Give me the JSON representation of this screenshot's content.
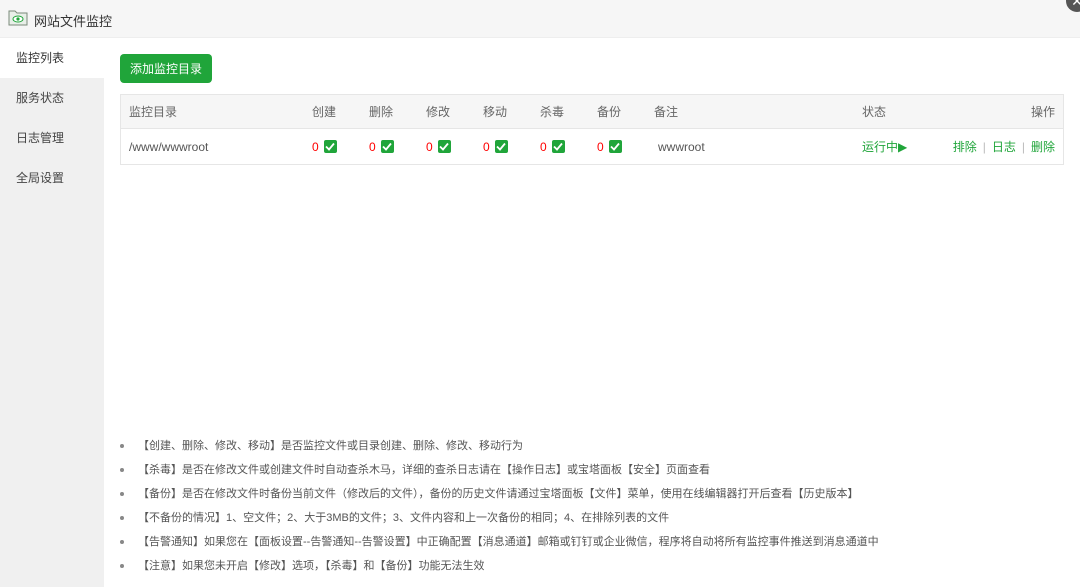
{
  "window": {
    "title": "网站文件监控",
    "close_glyph": "✕"
  },
  "sidebar": {
    "items": [
      {
        "label": "监控列表",
        "active": true
      },
      {
        "label": "服务状态"
      },
      {
        "label": "日志管理"
      },
      {
        "label": "全局设置"
      }
    ]
  },
  "toolbar": {
    "add_label": "添加监控目录"
  },
  "table": {
    "headers": {
      "dir": "监控目录",
      "create": "创建",
      "delete": "删除",
      "modify": "修改",
      "move": "移动",
      "kill": "杀毒",
      "backup": "备份",
      "note": "备注",
      "status": "状态",
      "ops": "操作"
    },
    "rows": [
      {
        "dir": "/www/wwwroot",
        "create": "0",
        "delete": "0",
        "modify": "0",
        "move": "0",
        "kill": "0",
        "backup": "0",
        "create_checked": true,
        "delete_checked": true,
        "modify_checked": true,
        "move_checked": true,
        "kill_checked": true,
        "backup_checked": true,
        "note": "wwwroot",
        "status": "运行中▶",
        "op_exclude": "排除",
        "op_log": "日志",
        "op_delete": "删除",
        "op_sep": "|"
      }
    ]
  },
  "notes": [
    "【创建、删除、修改、移动】是否监控文件或目录创建、删除、修改、移动行为",
    "【杀毒】是否在修改文件或创建文件时自动查杀木马，详细的查杀日志请在【操作日志】或宝塔面板【安全】页面查看",
    "【备份】是否在修改文件时备份当前文件（修改后的文件），备份的历史文件请通过宝塔面板【文件】菜单，使用在线编辑器打开后查看【历史版本】",
    "【不备份的情况】1、空文件；2、大于3MB的文件；3、文件内容和上一次备份的相同；4、在排除列表的文件",
    "【告警通知】如果您在【面板设置--告警通知--告警设置】中正确配置【消息通道】邮箱或钉钉或企业微信，程序将自动将所有监控事件推送到消息通道中",
    "【注意】如果您未开启【修改】选项，【杀毒】和【备份】功能无法生效"
  ],
  "colors": {
    "accent": "#20a53a",
    "count": "#ff0000"
  },
  "icons": {
    "title": "folder-eye-icon",
    "checkbox": "checkmark-icon"
  }
}
